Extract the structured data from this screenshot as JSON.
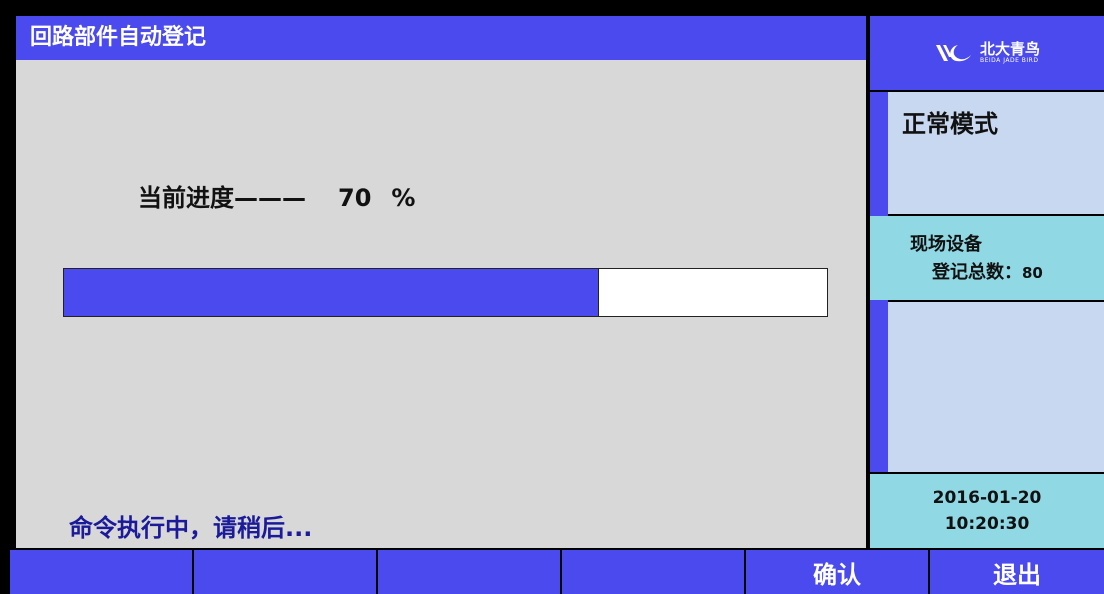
{
  "window": {
    "title": "回路部件自动登记"
  },
  "progress": {
    "label": "当前进度———",
    "value": "70",
    "unit": "%",
    "fraction": 0.7
  },
  "status": {
    "message": "命令执行中，请稍后..."
  },
  "sidebar": {
    "logo": {
      "text": "北大青鸟",
      "subtext": "BEIDA JADE BIRD",
      "icon": "jade-bird-logo-icon"
    },
    "mode": "正常模式",
    "count": {
      "line1": "现场设备",
      "line2_label": "登记总数：",
      "line2_value": "80"
    },
    "datetime": {
      "date": "2016-01-20",
      "time": "10:20:30"
    }
  },
  "function_keys": [
    {
      "label": ""
    },
    {
      "label": ""
    },
    {
      "label": ""
    },
    {
      "label": ""
    },
    {
      "label": "确认"
    },
    {
      "label": "退出"
    }
  ],
  "colors": {
    "accent_blue": "#4a4aee",
    "panel_gray": "#d8d8d8",
    "light_blue": "#c8d8f0",
    "cyan": "#8fd8e4",
    "status_text": "#1a1a9a"
  }
}
